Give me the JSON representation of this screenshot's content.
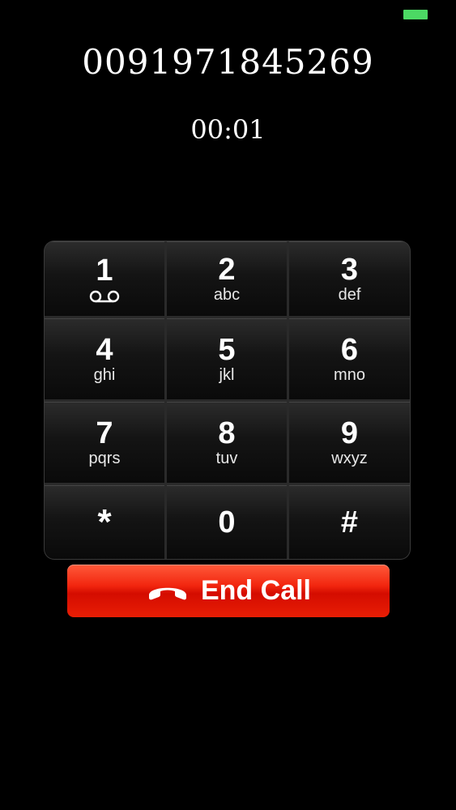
{
  "status": {
    "battery_color": "#4cd964"
  },
  "call": {
    "number": "0091971845269",
    "duration": "00:01"
  },
  "keypad": {
    "keys": [
      {
        "digit": "1",
        "letters": "",
        "icon": "voicemail-icon"
      },
      {
        "digit": "2",
        "letters": "abc"
      },
      {
        "digit": "3",
        "letters": "def"
      },
      {
        "digit": "4",
        "letters": "ghi"
      },
      {
        "digit": "5",
        "letters": "jkl"
      },
      {
        "digit": "6",
        "letters": "mno"
      },
      {
        "digit": "7",
        "letters": "pqrs"
      },
      {
        "digit": "8",
        "letters": "tuv"
      },
      {
        "digit": "9",
        "letters": "wxyz"
      },
      {
        "digit": "*",
        "letters": ""
      },
      {
        "digit": "0",
        "letters": ""
      },
      {
        "digit": "#",
        "letters": ""
      }
    ]
  },
  "end_call": {
    "label": "End Call",
    "icon": "phone-hangup-icon",
    "color": "#e81e05"
  }
}
